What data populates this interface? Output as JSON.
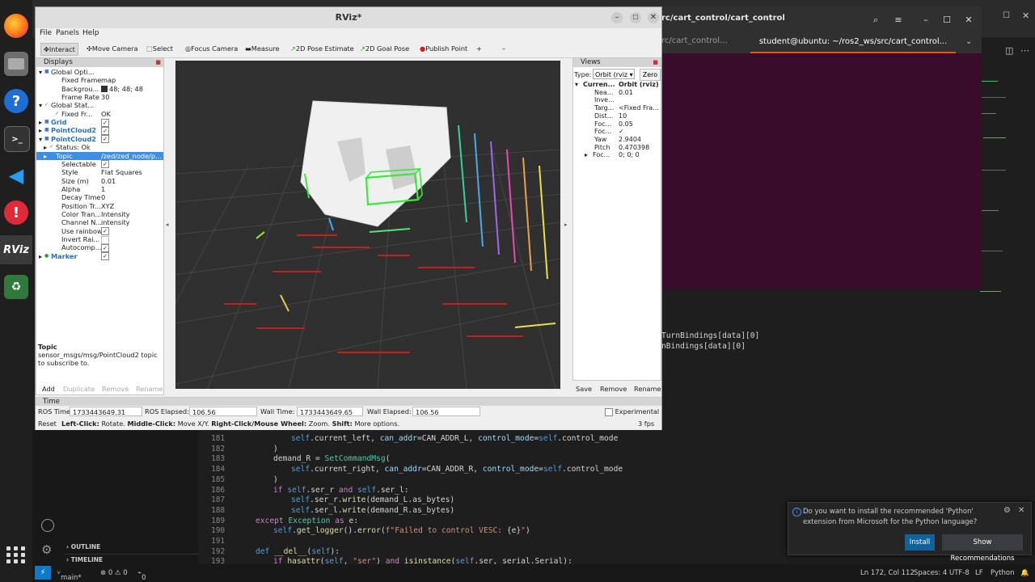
{
  "dock": {
    "items": [
      "firefox-icon",
      "files-icon",
      "help-icon",
      "terminal-icon",
      "vscode-icon",
      "update-icon",
      "rviz-icon",
      "trash-icon"
    ],
    "rviz_label": "RViz"
  },
  "terminal": {
    "title": "rc/cart_control/cart_control",
    "tab_left": "rc/cart_control...",
    "tab_active": "student@ubuntu: ~/ros2_ws/src/cart_control..."
  },
  "vscode": {
    "side_code": [
      {
        "line": "TurnBindings[data][0]"
      },
      {
        "line": "nBindings[data][0]"
      }
    ],
    "code_lines": [
      {
        "n": "181",
        "html": "    <span class='sf'>self</span>.current_left, <span class='va'>can_addr</span>=CAN_ADDR_L, <span class='va'>control_mode</span>=<span class='sf'>self</span>.control_mode"
      },
      {
        "n": "182",
        "html": "  )"
      },
      {
        "n": "183",
        "html": "  demand_R = <span class='cls'>SetCommandMsg</span>("
      },
      {
        "n": "184",
        "html": "    <span class='sf'>self</span>.current_right, <span class='va'>can_addr</span>=CAN_ADDR_R, <span class='va'>control_mode</span>=<span class='sf'>self</span>.control_mode"
      },
      {
        "n": "185",
        "html": "  )"
      },
      {
        "n": "186",
        "html": "  <span class='kw'>if</span> <span class='sf'>self</span>.ser_r <span class='kw'>and</span> <span class='sf'>self</span>.ser_l:"
      },
      {
        "n": "187",
        "html": "    <span class='sf'>self</span>.ser_r.<span class='fn'>write</span>(demand_L.as_bytes)"
      },
      {
        "n": "188",
        "html": "    <span class='sf'>self</span>.ser_l.<span class='fn'>write</span>(demand_R.as_bytes)"
      },
      {
        "n": "189",
        "html": "<span class='kw'>except</span> <span class='cls'>Exception</span> <span class='kw'>as</span> e:"
      },
      {
        "n": "190",
        "html": "  <span class='sf'>self</span>.<span class='fn'>get_logger</span>().<span class='fn'>error</span>(<span class='st'>f\"Failed to control VESC: </span>{e}<span class='st'>\"</span>)"
      },
      {
        "n": "191",
        "html": ""
      },
      {
        "n": "192",
        "html": "<span class='def'>def</span> <span class='fn'>__del__</span>(<span class='sf'>self</span>):"
      },
      {
        "n": "193",
        "html": "  <span class='kw'>if</span> <span class='fn'>hasattr</span>(<span class='sf'>self</span>, <span class='st'>\"ser\"</span>) <span class='kw'>and</span> <span class='fn'>isinstance</span>(<span class='sf'>self</span>.ser, serial.Serial):"
      }
    ],
    "outline_label": "OUTLINE",
    "timeline_label": "TIMELINE",
    "status": {
      "branch": "main*",
      "problems": "⊗ 0 ⚠ 0",
      "ports": "0",
      "position": "Ln 172, Col 112",
      "spaces": "Spaces: 4",
      "encoding": "UTF-8",
      "eol": "LF",
      "language": "Python"
    },
    "notification": {
      "message": "Do you want to install the recommended 'Python' extension from Microsoft for the Python language?",
      "install": "Install",
      "show": "Show Recommendations"
    }
  },
  "rviz": {
    "title": "RViz*",
    "menu": [
      "File",
      "Panels",
      "Help"
    ],
    "tools": [
      "Interact",
      "Move Camera",
      "Select",
      "Focus Camera",
      "Measure",
      "2D Pose Estimate",
      "2D Goal Pose",
      "Publish Point"
    ],
    "displays_header": "Displays",
    "displays": [
      {
        "key": "Global Opti...",
        "val": ""
      },
      {
        "key": "Fixed Frame",
        "val": "map"
      },
      {
        "key": "Backgrou...",
        "val": "48; 48; 48"
      },
      {
        "key": "Frame Rate",
        "val": "30"
      },
      {
        "key": "Global Stat...",
        "val": ""
      },
      {
        "key": "Fixed Fr...",
        "val": "OK"
      },
      {
        "key": "Grid",
        "val": ""
      },
      {
        "key": "PointCloud2",
        "val": ""
      },
      {
        "key": "PointCloud2",
        "val": ""
      },
      {
        "key": "Status: Ok",
        "val": ""
      },
      {
        "key": "Topic",
        "val": "/zed/zed_node/p..."
      },
      {
        "key": "Selectable",
        "val": ""
      },
      {
        "key": "Style",
        "val": "Flat Squares"
      },
      {
        "key": "Size (m)",
        "val": "0.01"
      },
      {
        "key": "Alpha",
        "val": "1"
      },
      {
        "key": "Decay Time",
        "val": "0"
      },
      {
        "key": "Position Tr...",
        "val": "XYZ"
      },
      {
        "key": "Color Tran...",
        "val": "Intensity"
      },
      {
        "key": "Channel N...",
        "val": "intensity"
      },
      {
        "key": "Use rainbow",
        "val": ""
      },
      {
        "key": "Invert Rai...",
        "val": ""
      },
      {
        "key": "Autocomp...",
        "val": ""
      },
      {
        "key": "Marker",
        "val": ""
      }
    ],
    "topic_title": "Topic",
    "topic_desc": "sensor_msgs/msg/PointCloud2 topic to subscribe to.",
    "panel_buttons": [
      "Add",
      "Duplicate",
      "Remove",
      "Rename"
    ],
    "views_header": "Views",
    "views_type_label": "Type:",
    "views_type_value": "Orbit (rviz",
    "views_zero": "Zero",
    "views": [
      {
        "key": "Curren...",
        "val": "Orbit (rviz)"
      },
      {
        "key": "Nea...",
        "val": "0.01"
      },
      {
        "key": "Inve...",
        "val": ""
      },
      {
        "key": "Targ...",
        "val": "<Fixed Fra..."
      },
      {
        "key": "Dist...",
        "val": "10"
      },
      {
        "key": "Foc...",
        "val": "0.05"
      },
      {
        "key": "Foc...",
        "val": ""
      },
      {
        "key": "Yaw",
        "val": "2.9404"
      },
      {
        "key": "Pitch",
        "val": "0.470398"
      },
      {
        "key": "Foc...",
        "val": "0; 0; 0"
      }
    ],
    "views_buttons": [
      "Save",
      "Remove",
      "Rename"
    ],
    "time": {
      "header": "Time",
      "ros_time_label": "ROS Time:",
      "ros_time": "1733443649.31",
      "ros_elapsed_label": "ROS Elapsed:",
      "ros_elapsed": "106.56",
      "wall_time_label": "Wall Time:",
      "wall_time": "1733443649.65",
      "wall_elapsed_label": "Wall Elapsed:",
      "wall_elapsed": "106.56",
      "experimental": "Experimental",
      "reset": "Reset",
      "hint_b1": "Left-Click:",
      "hint_t1": " Rotate. ",
      "hint_b2": "Middle-Click:",
      "hint_t2": " Move X/Y. ",
      "hint_b3": "Right-Click/Mouse Wheel:",
      "hint_t3": " Zoom. ",
      "hint_b4": "Shift:",
      "hint_t4": " More options.",
      "fps": "3 fps"
    }
  }
}
